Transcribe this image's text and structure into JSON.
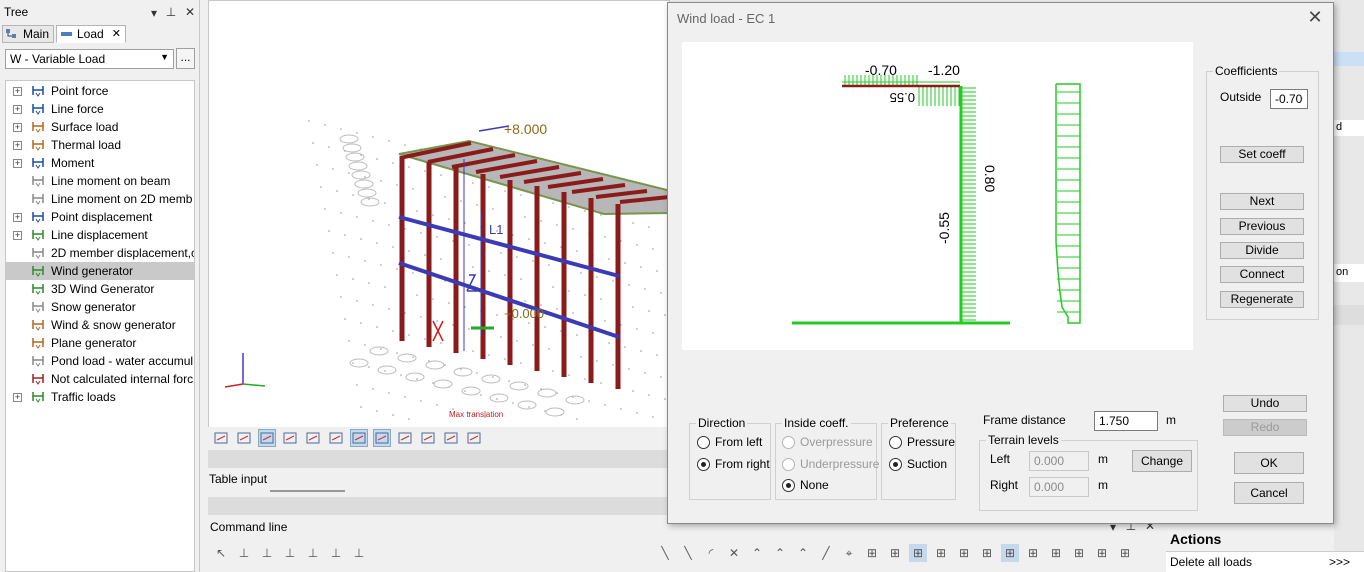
{
  "tree_panel": {
    "title": "Tree",
    "tabs": [
      {
        "label": "Main"
      },
      {
        "label": "Load"
      }
    ],
    "load_case": "W - Variable Load",
    "more_label": "...",
    "items": [
      {
        "label": "Point force",
        "expandable": true
      },
      {
        "label": "Line force",
        "expandable": true
      },
      {
        "label": "Surface load",
        "expandable": true
      },
      {
        "label": "Thermal load",
        "expandable": true
      },
      {
        "label": "Moment",
        "expandable": true
      },
      {
        "label": "Line moment on beam",
        "expandable": false
      },
      {
        "label": "Line moment on 2D memb",
        "expandable": false
      },
      {
        "label": "Point displacement",
        "expandable": true
      },
      {
        "label": "Line displacement",
        "expandable": true
      },
      {
        "label": "2D member displacement,c",
        "expandable": false
      },
      {
        "label": "Wind generator",
        "expandable": false,
        "selected": true
      },
      {
        "label": "3D Wind Generator",
        "expandable": false
      },
      {
        "label": "Snow generator",
        "expandable": false
      },
      {
        "label": "Wind & snow generator",
        "expandable": false
      },
      {
        "label": "Plane generator",
        "expandable": false
      },
      {
        "label": "Pond load - water accumul",
        "expandable": false
      },
      {
        "label": "Not calculated internal forc",
        "expandable": false
      },
      {
        "label": "Traffic loads",
        "expandable": true
      }
    ]
  },
  "viewport": {
    "dim_top": "+8.000",
    "dim_mid": "L1",
    "dim_low": "+0.000",
    "footnote": "Max translation"
  },
  "table_input_label": "Table input",
  "command_line_label": "Command line",
  "right_panel": {
    "actions_title": "Actions",
    "delete_all_label": "Delete all loads",
    "delete_all_button": ">>>",
    "partial_labels": [
      "d",
      "on"
    ]
  },
  "dialog": {
    "title": "Wind load - EC 1",
    "drawing": {
      "top_left_value": "-0.70",
      "top_right_value": "-1.20",
      "inner_value": "0.55",
      "right_wall_value": "0.80",
      "left_wall_value": "-0.55"
    },
    "coefficients": {
      "legend": "Coefficients",
      "outside_label": "Outside",
      "outside_value": "-0.700",
      "set_coeff": "Set coeff",
      "next": "Next",
      "previous": "Previous",
      "divide": "Divide",
      "connect": "Connect",
      "regenerate": "Regenerate"
    },
    "undo": "Undo",
    "redo": "Redo",
    "direction": {
      "legend": "Direction",
      "from_left": "From left",
      "from_right": "From right"
    },
    "inside_coeff": {
      "legend": "Inside coeff.",
      "overpressure": "Overpressure",
      "underpressure": "Underpressure",
      "none": "None"
    },
    "preference": {
      "legend": "Preference",
      "pressure": "Pressure",
      "suction": "Suction"
    },
    "frame_distance_label": "Frame distance",
    "frame_distance_value": "1.750",
    "unit_m": "m",
    "terrain": {
      "legend": "Terrain levels",
      "left_label": "Left",
      "left_value": "0.000",
      "right_label": "Right",
      "right_value": "0.000",
      "change": "Change"
    },
    "ok": "OK",
    "cancel": "Cancel"
  },
  "colors": {
    "selection": "#c9c9c9",
    "beam_red": "#8b1a1a",
    "bracing_blue": "#3b3bb5",
    "load_green": "#22cc22"
  }
}
